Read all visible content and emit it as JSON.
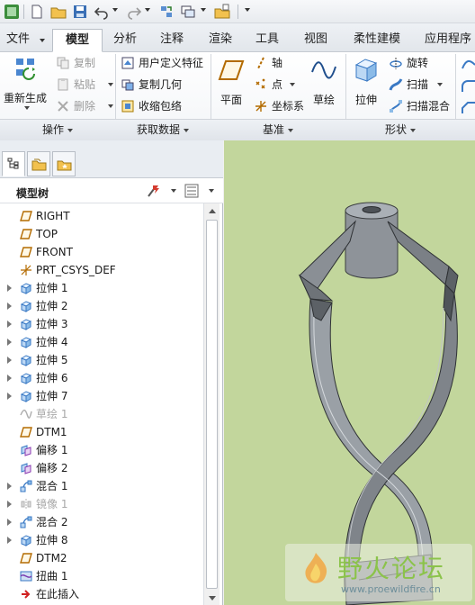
{
  "tabs": [
    {
      "label": "文件",
      "active": false,
      "has_dropdown": true
    },
    {
      "label": "模型",
      "active": true
    },
    {
      "label": "分析",
      "active": false
    },
    {
      "label": "注释",
      "active": false
    },
    {
      "label": "渲染",
      "active": false
    },
    {
      "label": "工具",
      "active": false
    },
    {
      "label": "视图",
      "active": false
    },
    {
      "label": "柔性建模",
      "active": false
    },
    {
      "label": "应用程序",
      "active": false
    }
  ],
  "ribbon": {
    "operations": {
      "regenerate_label": "重新生成",
      "copy_label": "复制",
      "paste_label": "粘贴",
      "delete_label": "删除",
      "group_label": "操作"
    },
    "get_data": {
      "udf_label": "用户定义特征",
      "copy_geom_label": "复制几何",
      "shrinkwrap_label": "收缩包络",
      "group_label": "获取数据"
    },
    "datum": {
      "plane_label": "平面",
      "axis_label": "轴",
      "point_label": "点",
      "csys_label": "坐标系",
      "sketch_label": "草绘",
      "group_label": "基准"
    },
    "shapes": {
      "extrude_label": "拉伸",
      "revolve_label": "旋转",
      "sweep_label": "扫描",
      "swept_blend_label": "扫描混合",
      "group_label": "形状"
    }
  },
  "model_tree": {
    "title": "模型树",
    "items": [
      {
        "label": "RIGHT",
        "icon": "datum-plane-icon",
        "expandable": false,
        "suppressed": false
      },
      {
        "label": "TOP",
        "icon": "datum-plane-icon",
        "expandable": false,
        "suppressed": false
      },
      {
        "label": "FRONT",
        "icon": "datum-plane-icon",
        "expandable": false,
        "suppressed": false
      },
      {
        "label": "PRT_CSYS_DEF",
        "icon": "csys-icon",
        "expandable": false,
        "suppressed": false
      },
      {
        "label": "拉伸 1",
        "icon": "extrude-icon",
        "expandable": true,
        "suppressed": false
      },
      {
        "label": "拉伸 2",
        "icon": "extrude-icon",
        "expandable": true,
        "suppressed": false
      },
      {
        "label": "拉伸 3",
        "icon": "extrude-icon",
        "expandable": true,
        "suppressed": false
      },
      {
        "label": "拉伸 4",
        "icon": "extrude-icon",
        "expandable": true,
        "suppressed": false
      },
      {
        "label": "拉伸 5",
        "icon": "extrude-icon",
        "expandable": true,
        "suppressed": false
      },
      {
        "label": "拉伸 6",
        "icon": "extrude-icon",
        "expandable": true,
        "suppressed": false
      },
      {
        "label": "拉伸 7",
        "icon": "extrude-icon",
        "expandable": true,
        "suppressed": false
      },
      {
        "label": "草绘 1",
        "icon": "sketch-icon",
        "expandable": false,
        "suppressed": true
      },
      {
        "label": "DTM1",
        "icon": "datum-plane-icon",
        "expandable": false,
        "suppressed": false
      },
      {
        "label": "偏移 1",
        "icon": "offset-icon",
        "expandable": false,
        "suppressed": false
      },
      {
        "label": "偏移 2",
        "icon": "offset-icon",
        "expandable": false,
        "suppressed": false
      },
      {
        "label": "混合 1",
        "icon": "blend-icon",
        "expandable": true,
        "suppressed": false
      },
      {
        "label": "镜像 1",
        "icon": "mirror-icon",
        "expandable": true,
        "suppressed": true
      },
      {
        "label": "混合 2",
        "icon": "blend-icon",
        "expandable": true,
        "suppressed": false
      },
      {
        "label": "拉伸 8",
        "icon": "extrude-icon",
        "expandable": true,
        "suppressed": false
      },
      {
        "label": "DTM2",
        "icon": "datum-plane-icon",
        "expandable": false,
        "suppressed": false
      },
      {
        "label": "扭曲 1",
        "icon": "warp-icon",
        "expandable": false,
        "suppressed": false
      },
      {
        "label": "在此插入",
        "icon": "insert-here-icon",
        "expandable": false,
        "suppressed": false
      }
    ]
  },
  "watermark": {
    "text": "野火论坛",
    "url": "www.proewildfire.cn"
  },
  "colors": {
    "graphics_bg": "#c2d69c",
    "model_fill": "#8b9096",
    "datum_plane_icon": "#b36b00"
  }
}
